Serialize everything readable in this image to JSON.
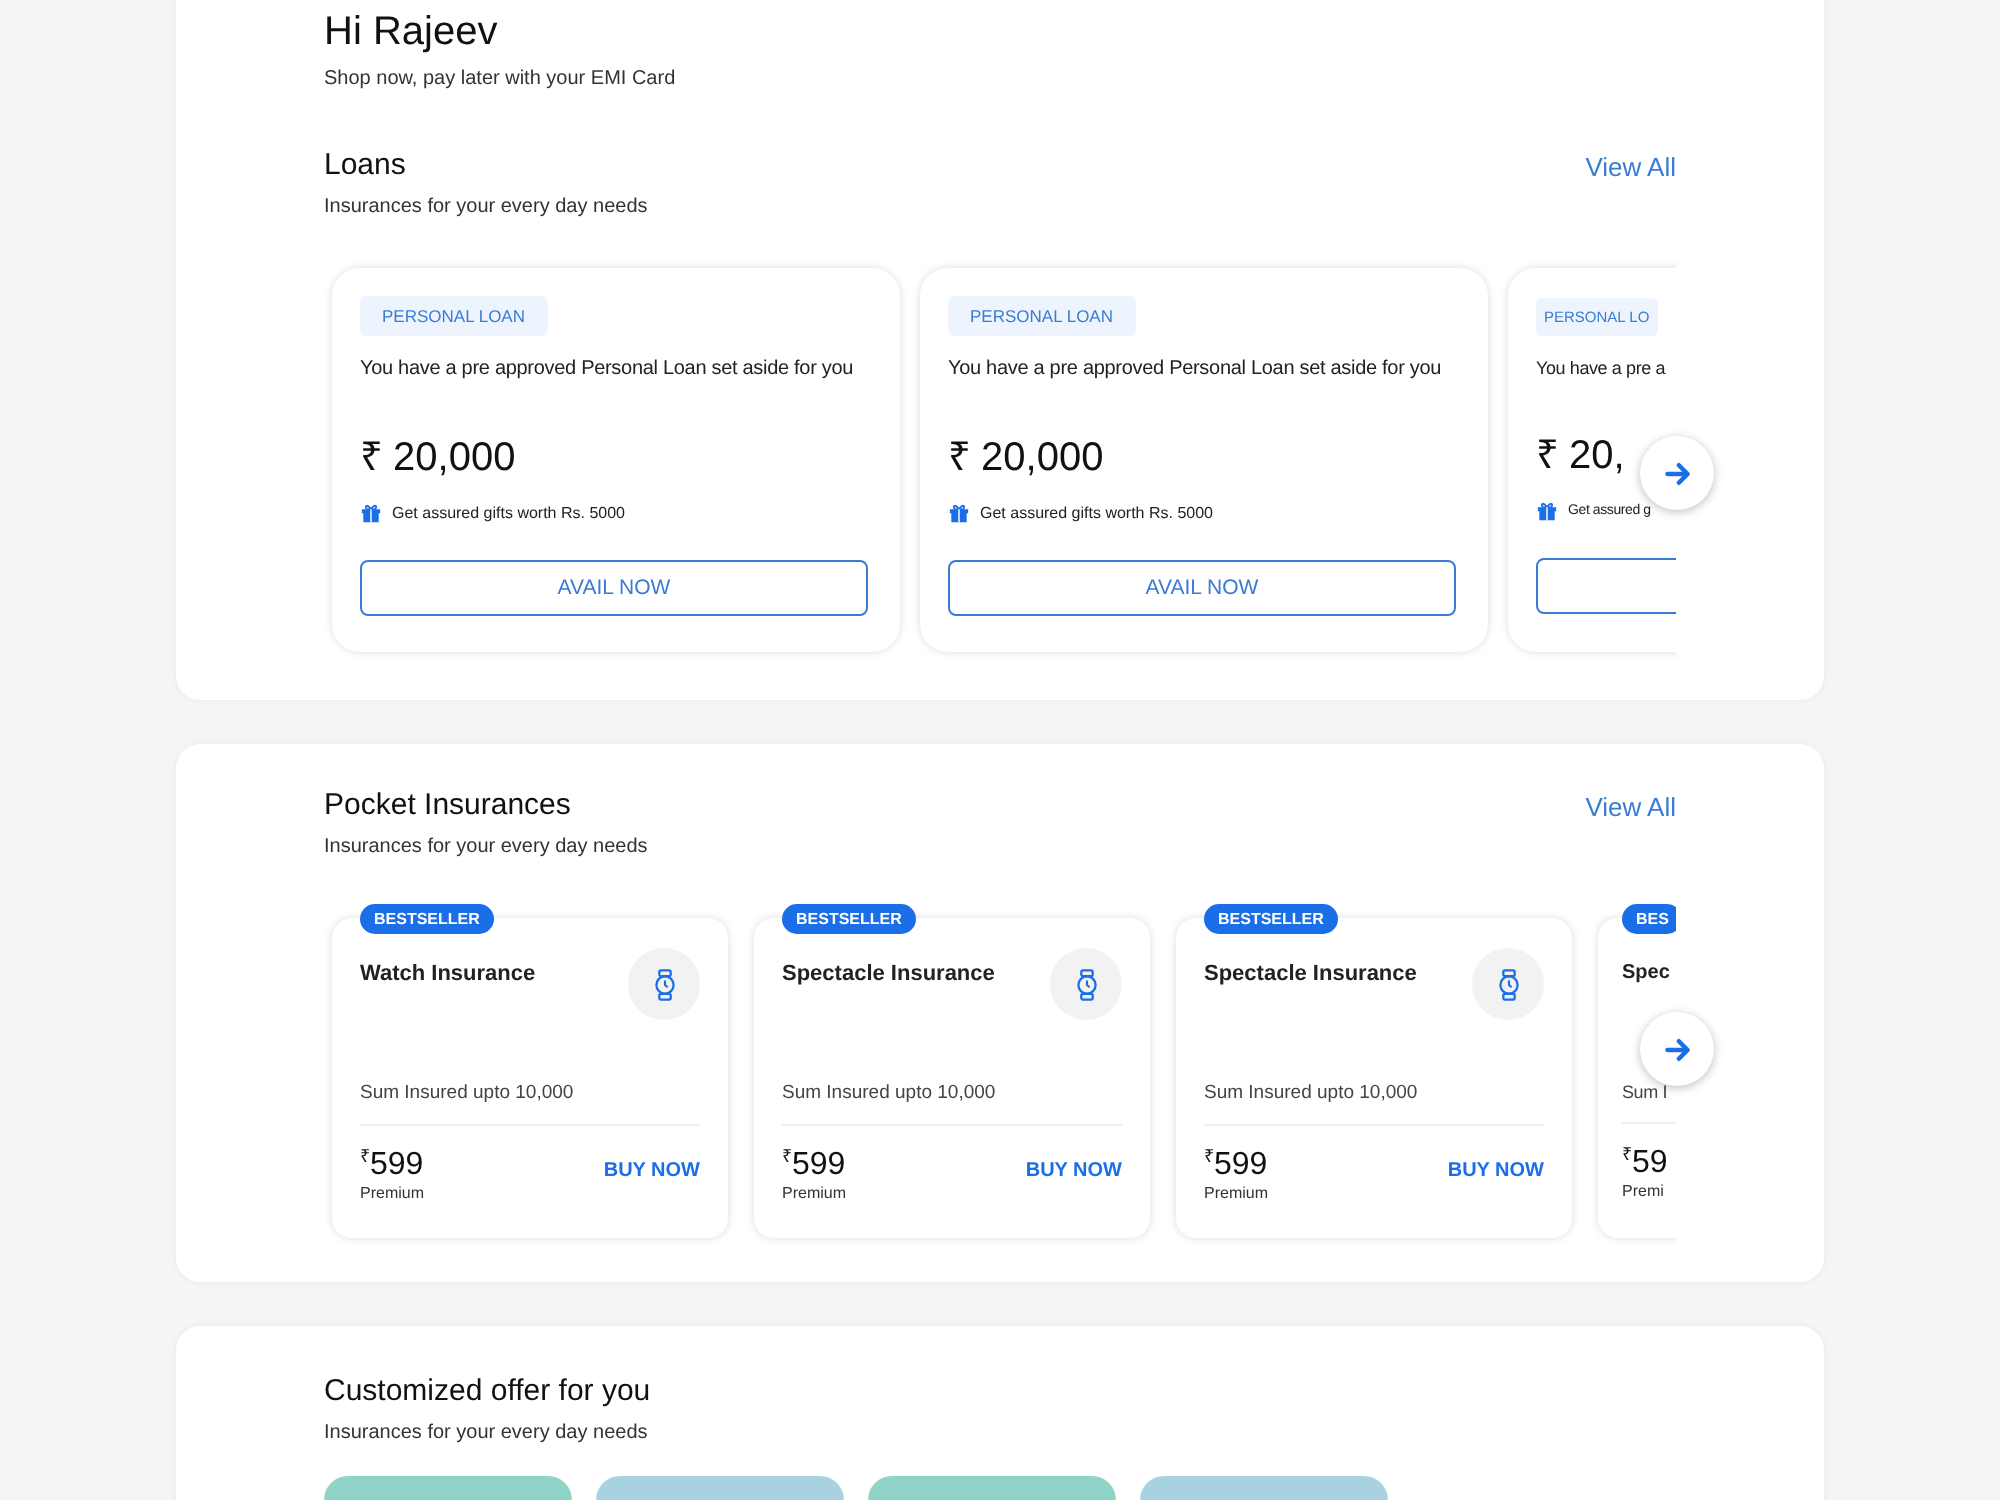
{
  "greeting": {
    "title": "Hi Rajeev",
    "subtitle": "Shop now, pay later with your EMI Card"
  },
  "loans": {
    "title": "Loans",
    "subtitle": "Insurances for your every day needs",
    "view_all": "View All",
    "cards": [
      {
        "kind": "full",
        "badge": "PERSONAL LOAN",
        "description": "You have a pre approved Personal Loan set aside for you",
        "amount": "₹ 20,000",
        "gift_text": "Get assured gifts worth Rs. 5000",
        "button": "AVAIL NOW"
      },
      {
        "kind": "full",
        "badge": "PERSONAL LOAN",
        "description": "You have a pre approved Personal Loan set aside for you",
        "amount": "₹ 20,000",
        "gift_text": "Get assured gifts worth Rs. 5000",
        "button": "AVAIL NOW"
      },
      {
        "kind": "partial",
        "badge": "PERSONAL LO",
        "description": "You have a pre a",
        "amount": "₹ 20,",
        "gift_text": "Get assured g"
      }
    ]
  },
  "insurances": {
    "title": "Pocket Insurances",
    "subtitle": "Insurances for your every day needs",
    "view_all": "View All",
    "cards": [
      {
        "kind": "full",
        "badge": "BESTSELLER",
        "title": "Watch Insurance",
        "sum_insured": "Sum Insured upto 10,000",
        "price": "$^{₹}$599",
        "price_label": "Premium",
        "button": "BUY NOW"
      },
      {
        "kind": "full",
        "badge": "BESTSELLER",
        "title": "Spectacle Insurance",
        "sum_insured": "Sum Insured upto 10,000",
        "price": "$^{₹}$599",
        "price_label": "Premium",
        "button": "BUY NOW"
      },
      {
        "kind": "full",
        "badge": "BESTSELLER",
        "title": "Spectacle Insurance",
        "sum_insured": "Sum Insured upto 10,000",
        "price": "$^{₹}$599",
        "price_label": "Premium",
        "button": "BUY NOW"
      },
      {
        "kind": "partial",
        "badge": "BES",
        "title": "Spec",
        "sum_insured": "Sum I",
        "price": "$^{₹}$59",
        "price_label": "Premi"
      }
    ]
  },
  "offers": {
    "title": "Customized offer for you",
    "subtitle": "Insurances for your every day needs",
    "tiles": [
      {
        "color": "#8fd3c9"
      },
      {
        "color": "#a9d2e0"
      },
      {
        "color": "#8fd3c9"
      },
      {
        "color": "#a9d2e0"
      }
    ]
  }
}
